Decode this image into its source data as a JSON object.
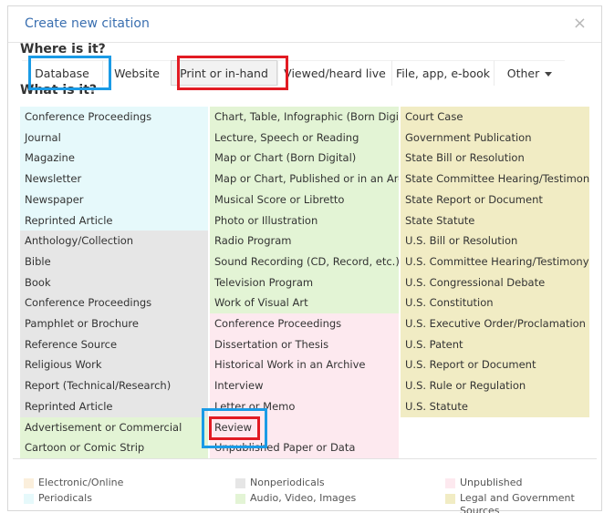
{
  "dialog": {
    "title": "Create new citation",
    "close_label": "×",
    "where_label": "Where is it?",
    "what_label": "What is it?"
  },
  "tabs": [
    {
      "label": "Database"
    },
    {
      "label": "Website"
    },
    {
      "label": "Print or in-hand"
    },
    {
      "label": "Viewed/heard live"
    },
    {
      "label": "File, app, e-book"
    },
    {
      "label": "Other"
    }
  ],
  "columns": [
    [
      {
        "label": "Conference Proceedings",
        "category": "periodical"
      },
      {
        "label": "Journal",
        "category": "periodical"
      },
      {
        "label": "Magazine",
        "category": "periodical"
      },
      {
        "label": "Newsletter",
        "category": "periodical"
      },
      {
        "label": "Newspaper",
        "category": "periodical"
      },
      {
        "label": "Reprinted Article",
        "category": "periodical"
      },
      {
        "label": "Anthology/Collection",
        "category": "nonperiodical"
      },
      {
        "label": "Bible",
        "category": "nonperiodical"
      },
      {
        "label": "Book",
        "category": "nonperiodical"
      },
      {
        "label": "Conference Proceedings",
        "category": "nonperiodical"
      },
      {
        "label": "Pamphlet or Brochure",
        "category": "nonperiodical"
      },
      {
        "label": "Reference Source",
        "category": "nonperiodical"
      },
      {
        "label": "Religious Work",
        "category": "nonperiodical"
      },
      {
        "label": "Report (Technical/Research)",
        "category": "nonperiodical"
      },
      {
        "label": "Reprinted Article",
        "category": "nonperiodical"
      },
      {
        "label": "Advertisement or Commercial",
        "category": "audio"
      },
      {
        "label": "Cartoon or Comic Strip",
        "category": "audio"
      }
    ],
    [
      {
        "label": "Chart, Table, Infographic (Born Digital)",
        "category": "audio"
      },
      {
        "label": "Lecture, Speech or Reading",
        "category": "audio"
      },
      {
        "label": "Map or Chart (Born Digital)",
        "category": "audio"
      },
      {
        "label": "Map or Chart, Published or in an Archive",
        "category": "audio"
      },
      {
        "label": "Musical Score or Libretto",
        "category": "audio"
      },
      {
        "label": "Photo or Illustration",
        "category": "audio"
      },
      {
        "label": "Radio Program",
        "category": "audio"
      },
      {
        "label": "Sound Recording (CD, Record, etc.)",
        "category": "audio"
      },
      {
        "label": "Television Program",
        "category": "audio"
      },
      {
        "label": "Work of Visual Art",
        "category": "audio"
      },
      {
        "label": "Conference Proceedings",
        "category": "unpublished"
      },
      {
        "label": "Dissertation or Thesis",
        "category": "unpublished"
      },
      {
        "label": "Historical Work in an Archive",
        "category": "unpublished"
      },
      {
        "label": "Interview",
        "category": "unpublished"
      },
      {
        "label": "Letter or Memo",
        "category": "unpublished"
      },
      {
        "label": "Review",
        "category": "unpublished"
      },
      {
        "label": "Unpublished Paper or Data",
        "category": "unpublished"
      }
    ],
    [
      {
        "label": "Court Case",
        "category": "legal"
      },
      {
        "label": "Government Publication",
        "category": "legal"
      },
      {
        "label": "State Bill or Resolution",
        "category": "legal"
      },
      {
        "label": "State Committee Hearing/Testimony",
        "category": "legal"
      },
      {
        "label": "State Report or Document",
        "category": "legal"
      },
      {
        "label": "State Statute",
        "category": "legal"
      },
      {
        "label": "U.S. Bill or Resolution",
        "category": "legal"
      },
      {
        "label": "U.S. Committee Hearing/Testimony",
        "category": "legal"
      },
      {
        "label": "U.S. Congressional Debate",
        "category": "legal"
      },
      {
        "label": "U.S. Constitution",
        "category": "legal"
      },
      {
        "label": "U.S. Executive Order/Proclamation",
        "category": "legal"
      },
      {
        "label": "U.S. Patent",
        "category": "legal"
      },
      {
        "label": "U.S. Report or Document",
        "category": "legal"
      },
      {
        "label": "U.S. Rule or Regulation",
        "category": "legal"
      },
      {
        "label": "U.S. Statute",
        "category": "legal"
      }
    ]
  ],
  "legend": [
    {
      "label": "Electronic/Online",
      "category": "online"
    },
    {
      "label": "Nonperiodicals",
      "category": "nonperiodical"
    },
    {
      "label": "Unpublished",
      "category": "unpublished"
    },
    {
      "label": "Periodicals",
      "category": "periodical"
    },
    {
      "label": "Audio, Video, Images",
      "category": "audio"
    },
    {
      "label": "Legal and Government Sources",
      "category": "legal"
    }
  ],
  "colors": {
    "periodical": "#e6f9fb",
    "nonperiodical": "#e6e6e6",
    "audio": "#e3f4d5",
    "unpublished": "#fde9ef",
    "legal": "#f1ecc4",
    "online": "#fbefdc",
    "title": "#3a6fb0",
    "highlight_blue": "#1a9be6",
    "highlight_red": "#e21b23"
  }
}
